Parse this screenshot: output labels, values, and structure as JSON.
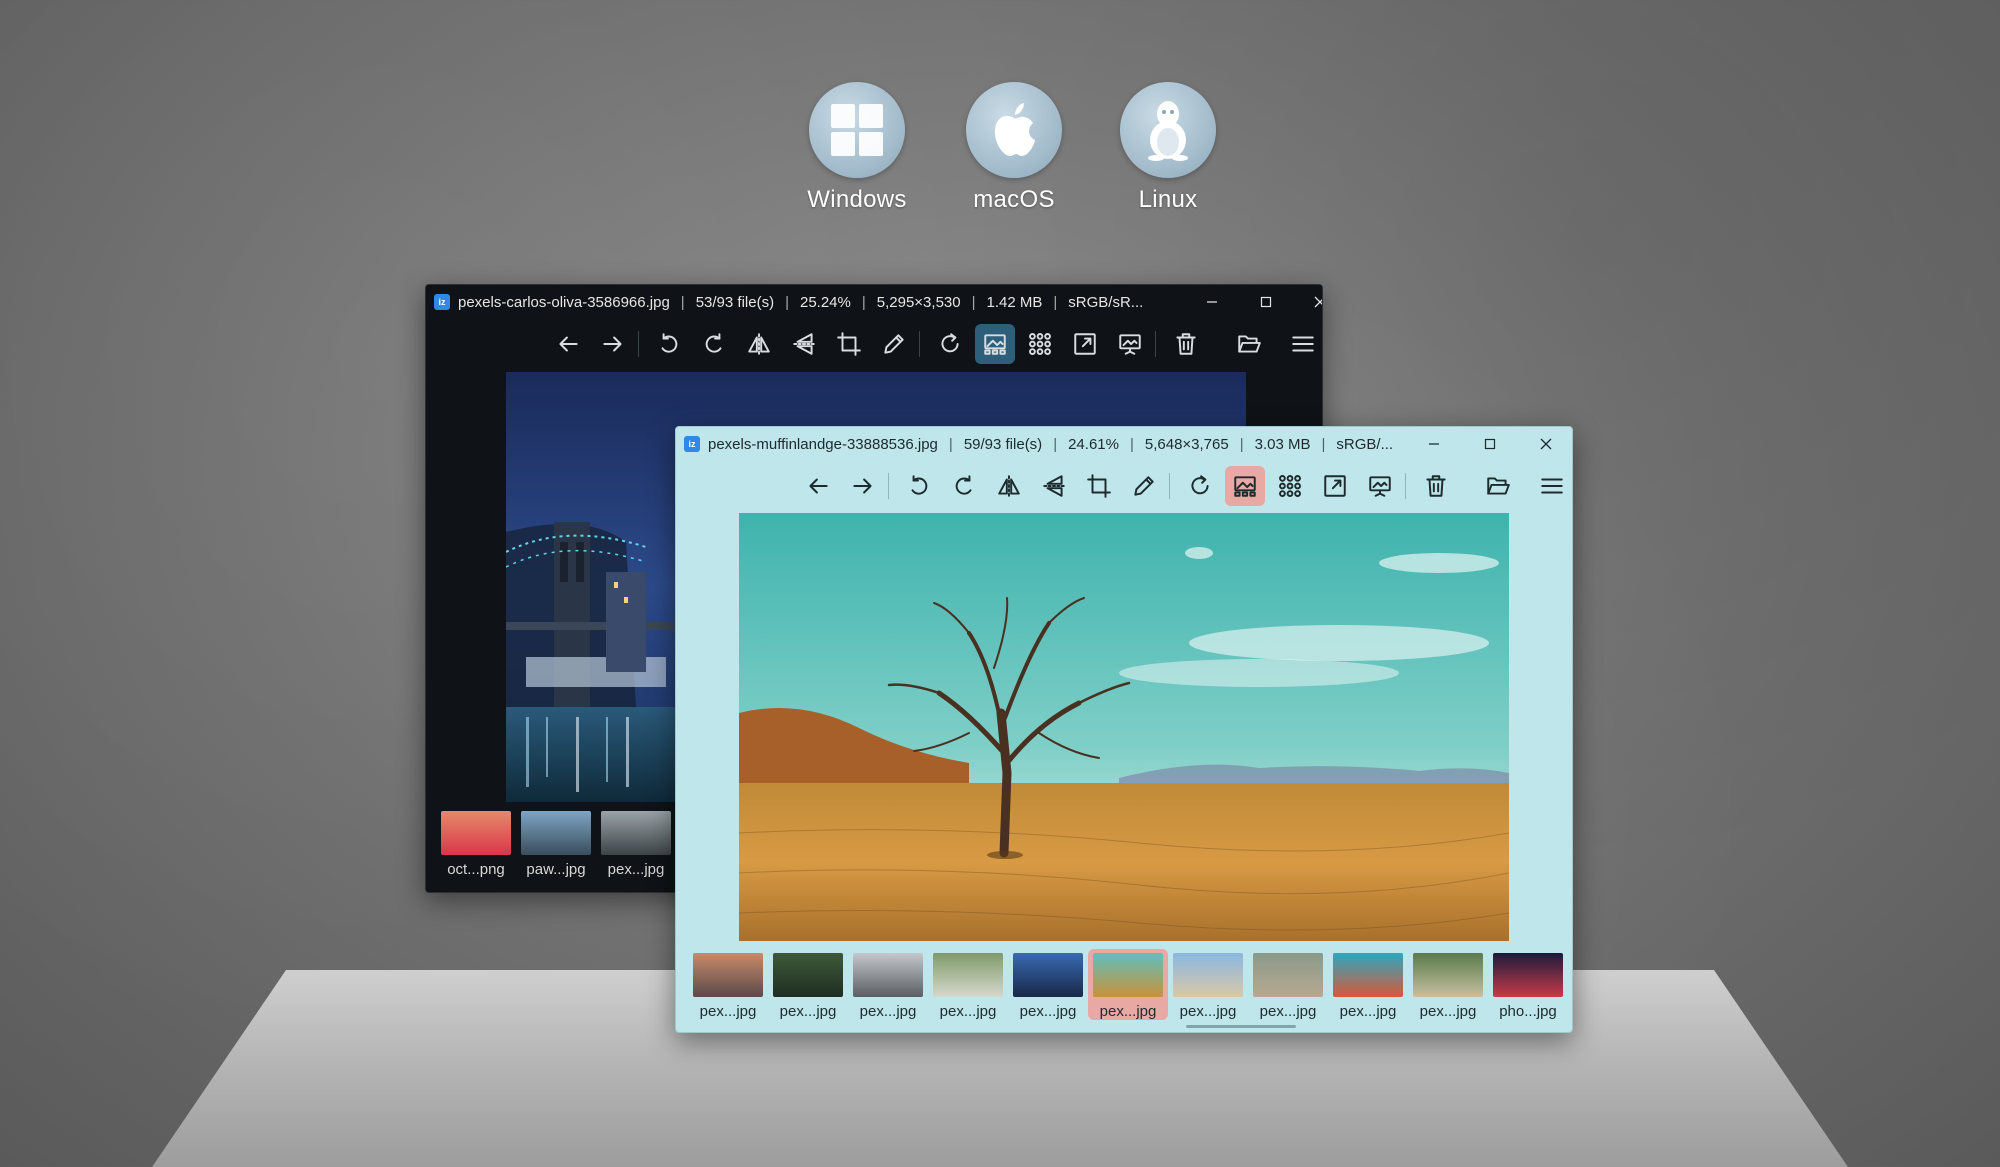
{
  "platforms": [
    {
      "label": "Windows",
      "icon": "windows-logo-icon"
    },
    {
      "label": "macOS",
      "icon": "apple-logo-icon"
    },
    {
      "label": "Linux",
      "icon": "linux-tux-icon"
    }
  ],
  "back_window": {
    "filename": "pexels-carlos-oliva-3586966.jpg",
    "file_index": "53/93 file(s)",
    "zoom": "25.24%",
    "dimensions": "5,295×3,530",
    "size": "1.42 MB",
    "color_profile": "sRGB/sR...",
    "app_icon_text": "iz",
    "thumbnails": [
      {
        "name": "oct...png",
        "colors": [
          "#e58a6a",
          "#d9364a"
        ]
      },
      {
        "name": "paw...jpg",
        "colors": [
          "#7fa4c4",
          "#3a4d5c"
        ]
      },
      {
        "name": "pex...jpg",
        "colors": [
          "#9aa3a8",
          "#3d4448"
        ]
      }
    ]
  },
  "front_window": {
    "filename": "pexels-muffinlandge-33888536.jpg",
    "file_index": "59/93 file(s)",
    "zoom": "24.61%",
    "dimensions": "5,648×3,765",
    "size": "3.03 MB",
    "color_profile": "sRGB/...",
    "app_icon_text": "iz",
    "thumbnails": [
      {
        "name": "pex...jpg",
        "colors": [
          "#c98a6a",
          "#5a4a4a"
        ],
        "selected": false
      },
      {
        "name": "pex...jpg",
        "colors": [
          "#3d5a3a",
          "#1f2d22"
        ],
        "selected": false
      },
      {
        "name": "pex...jpg",
        "colors": [
          "#c4c8cc",
          "#5a5e62"
        ],
        "selected": false
      },
      {
        "name": "pex...jpg",
        "colors": [
          "#7f9a6a",
          "#d6d8cc"
        ],
        "selected": false
      },
      {
        "name": "pex...jpg",
        "colors": [
          "#3a6ab0",
          "#18284a"
        ],
        "selected": false
      },
      {
        "name": "pex...jpg",
        "colors": [
          "#5fc0bd",
          "#c8923a"
        ],
        "selected": true
      },
      {
        "name": "pex...jpg",
        "colors": [
          "#8ab8e0",
          "#d8c8a8"
        ],
        "selected": false
      },
      {
        "name": "pex...jpg",
        "colors": [
          "#8a9a8a",
          "#b8a890"
        ],
        "selected": false
      },
      {
        "name": "pex...jpg",
        "colors": [
          "#2aa8c0",
          "#d8583a"
        ],
        "selected": false
      },
      {
        "name": "pex...jpg",
        "colors": [
          "#5a7a4a",
          "#c8c0a0"
        ],
        "selected": false
      },
      {
        "name": "pho...jpg",
        "colors": [
          "#1a1a3a",
          "#c83a4a"
        ],
        "selected": false
      }
    ]
  },
  "toolbar_tools": [
    "previous-icon",
    "next-icon",
    "rotate-left-icon",
    "rotate-right-icon",
    "flip-horizontal-icon",
    "flip-vertical-icon",
    "crop-icon",
    "edit-pencil-icon",
    "refresh-icon",
    "gallery-view-icon",
    "thumbnail-grid-icon",
    "fullscreen-icon",
    "slideshow-icon",
    "delete-icon",
    "open-folder-icon",
    "main-menu-icon"
  ],
  "colors": {
    "dark_window_bg": "#0f1216",
    "light_window_bg": "#bfe6ea",
    "light_active_tool": "#e8a8a4",
    "dark_active_tool": "#2e5f7a"
  }
}
